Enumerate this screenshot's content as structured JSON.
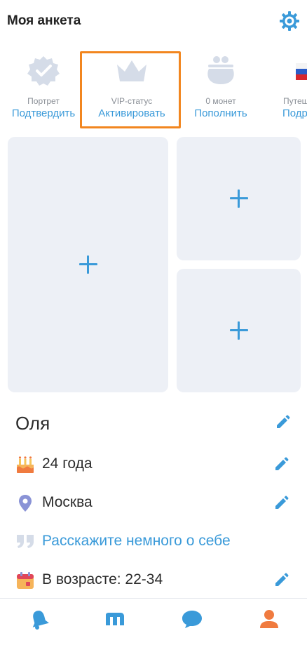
{
  "header": {
    "title": "Моя анкета",
    "settings_icon": "gear-icon"
  },
  "stats": [
    {
      "caption": "Портрет",
      "action": "Подтвердить",
      "icon": "verified-badge-icon"
    },
    {
      "caption": "VIP-статус",
      "action": "Активировать",
      "icon": "crown-icon",
      "highlighted": true
    },
    {
      "caption": "0 монет",
      "action": "Пополнить",
      "icon": "coin-purse-icon"
    },
    {
      "caption": "Путеш",
      "action": "Подр",
      "icon": "russia-flag-icon"
    }
  ],
  "photos": {
    "add_icon": "plus-icon",
    "slots": 3
  },
  "profile": {
    "name": "Оля",
    "age": "24 года",
    "city": "Москва",
    "about_placeholder": "Расскажите немного о себе",
    "looking_for": "В возрасте: 22-34"
  },
  "bottom_nav": [
    {
      "name": "notifications",
      "icon": "bell-icon"
    },
    {
      "name": "meetings",
      "icon": "m-logo-icon"
    },
    {
      "name": "messages",
      "icon": "chat-bubble-icon"
    },
    {
      "name": "profile",
      "icon": "user-icon",
      "active": true
    }
  ],
  "colors": {
    "accent": "#3a9ad9",
    "highlight_border": "#f2861f",
    "icon_muted": "#d5dce8",
    "photo_placeholder": "#edf0f6",
    "profile_active": "#f07b3f"
  }
}
